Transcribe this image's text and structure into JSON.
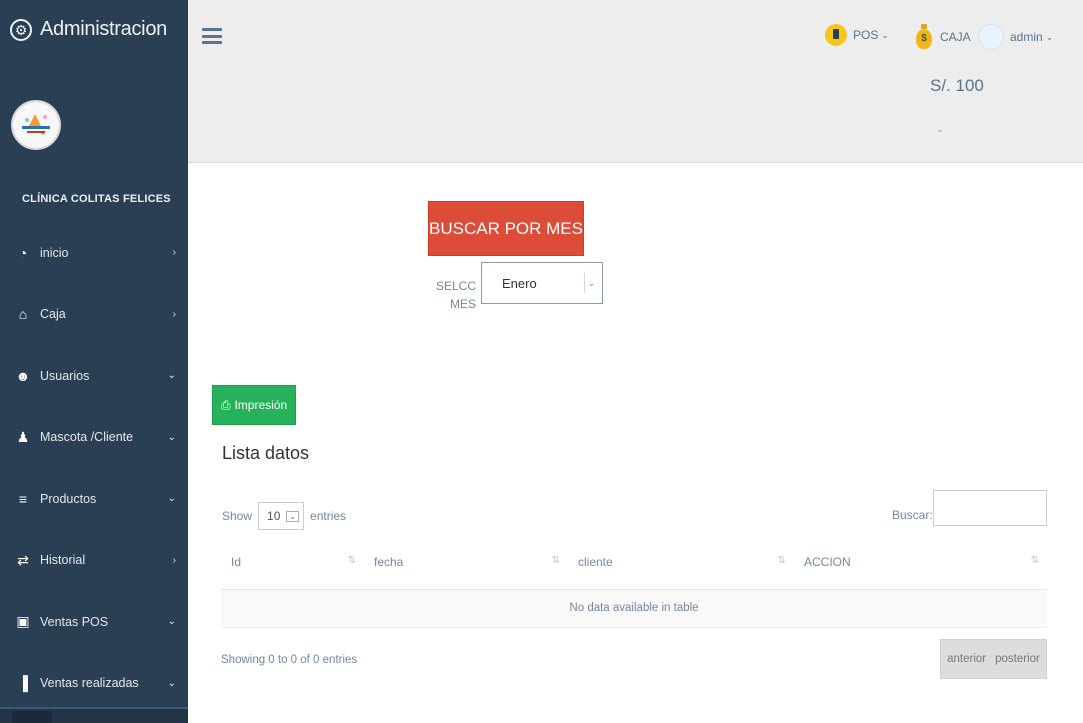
{
  "app": {
    "title": "Administracion",
    "clinic_name": "CLÍNICA COLITAS FELICES"
  },
  "sidebar": {
    "items": [
      {
        "label": "inicio",
        "icon": "dashboard-icon",
        "glyph": "◔",
        "arrow": "›"
      },
      {
        "label": "Caja",
        "icon": "bank-icon",
        "glyph": "⌂",
        "arrow": "›"
      },
      {
        "label": "Usuarios",
        "icon": "users-icon",
        "glyph": "☻",
        "arrow": "⌄"
      },
      {
        "label": "Mascota /Cliente",
        "icon": "pet-client-icon",
        "glyph": "♟",
        "arrow": "⌄"
      },
      {
        "label": "Productos",
        "icon": "database-icon",
        "glyph": "≡",
        "arrow": "⌄"
      },
      {
        "label": "Historial",
        "icon": "exchange-icon",
        "glyph": "⇄",
        "arrow": "›"
      },
      {
        "label": "Ventas POS",
        "icon": "money-icon",
        "glyph": "▣",
        "arrow": "⌄"
      },
      {
        "label": "Ventas realizadas",
        "icon": "bar-chart-icon",
        "glyph": "▐",
        "arrow": "⌄"
      }
    ]
  },
  "topnav": {
    "pos_label": "POS",
    "caja_label": "CAJA",
    "caja_amount": "S/. 100",
    "admin_label": "admin",
    "caret": "⌄"
  },
  "main": {
    "search_month_button": "BUSCAR POR MES",
    "select_month_label": "SELCCI MES",
    "selected_month": "Enero",
    "print_button": "Impresión",
    "list_title": "Lista datos",
    "show_label": "Show",
    "page_length": "10",
    "entries_label": "entries",
    "search_label": "Buscar:",
    "columns": [
      "Id",
      "fecha",
      "cliente",
      "ACCION"
    ],
    "empty_message": "No data available in table",
    "showing_info": "Showing 0 to 0 of 0 entries",
    "prev_label": "anterior",
    "next_label": "posterior"
  },
  "colors": {
    "sidebar": "#2a3f54",
    "topbar": "#ededed",
    "danger": "#dd4b39",
    "success": "#26b15a"
  }
}
